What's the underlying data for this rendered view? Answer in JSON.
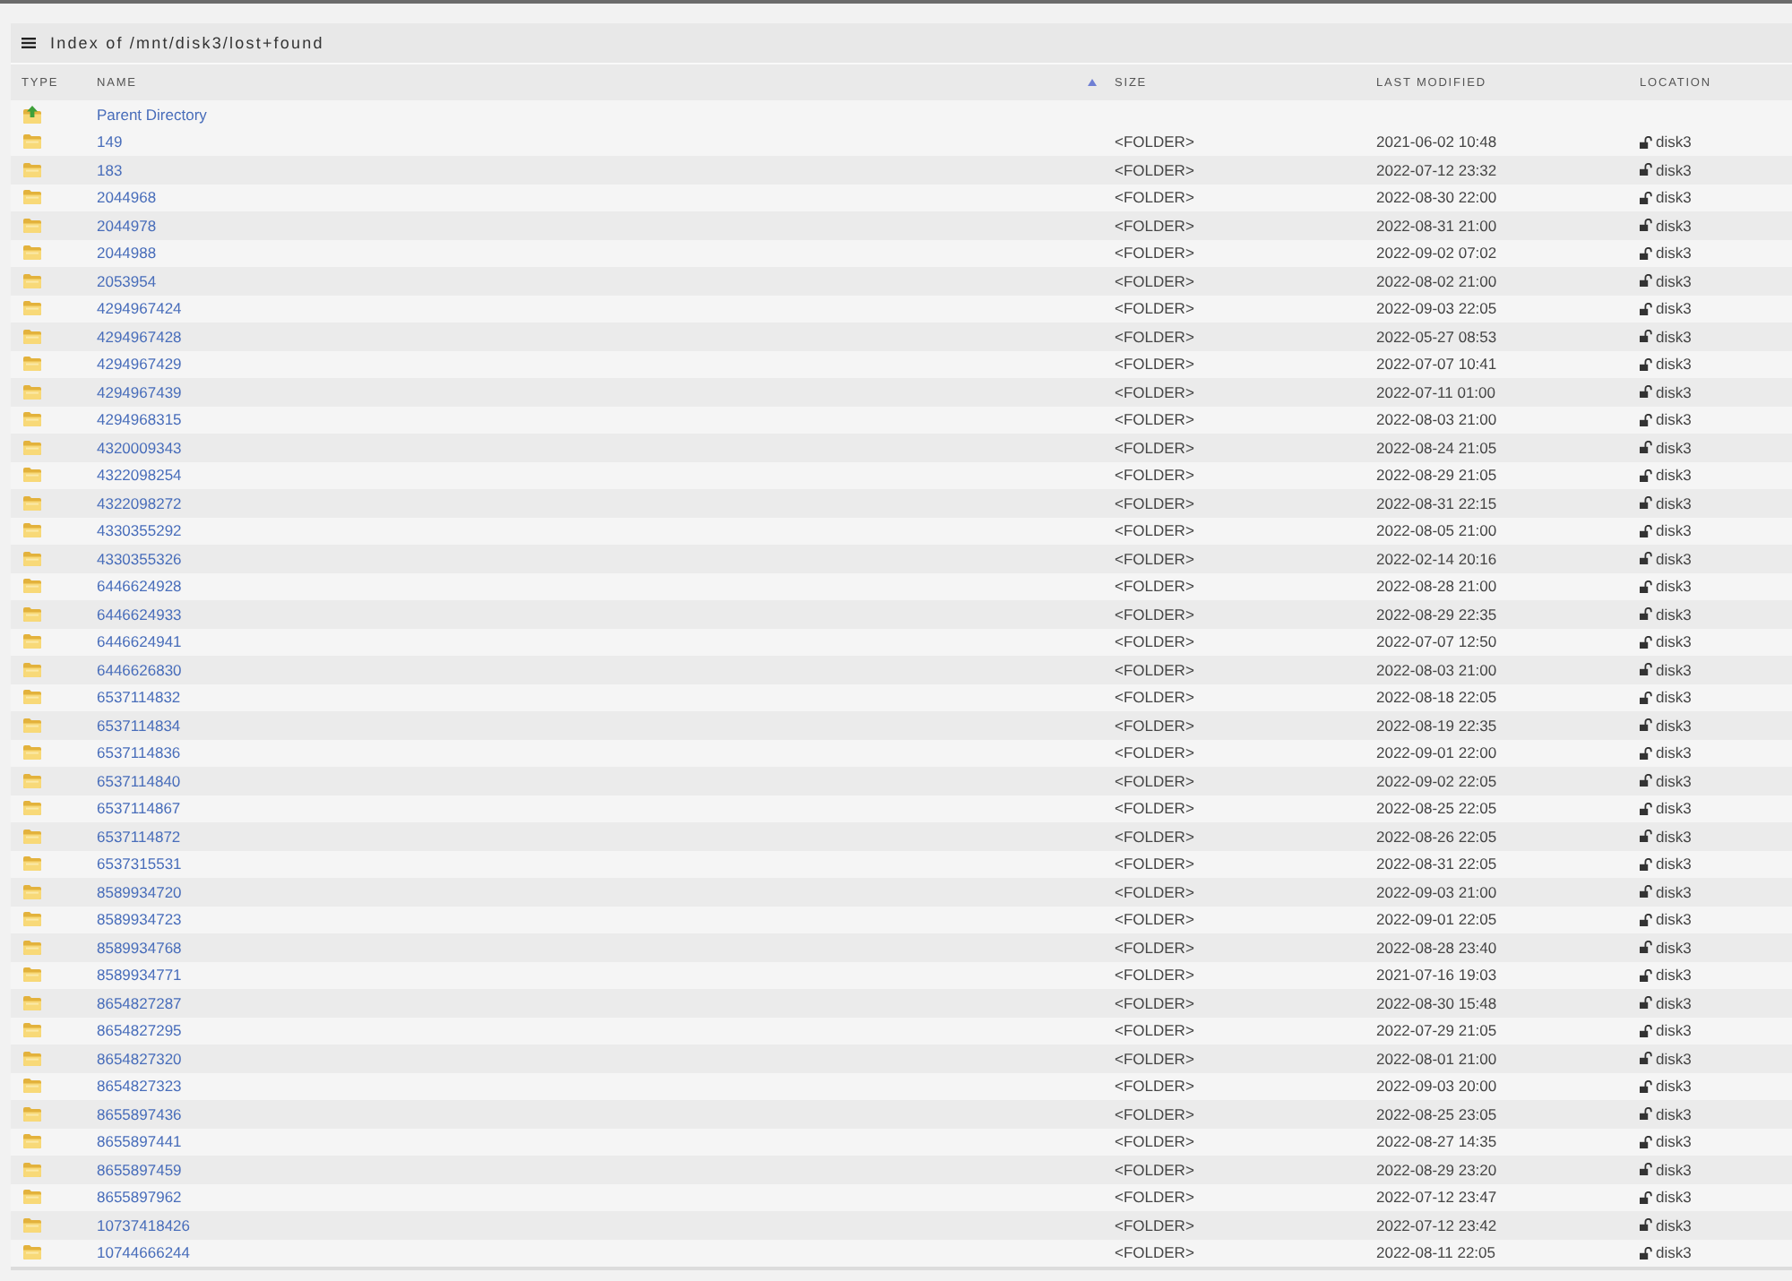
{
  "window": {
    "title": "Index of /mnt/disk3/lost+found"
  },
  "table": {
    "columns": [
      {
        "label": "TYPE",
        "sorted": false
      },
      {
        "label": "NAME",
        "sorted": true
      },
      {
        "label": "SIZE",
        "sorted": false
      },
      {
        "label": "LAST MODIFIED",
        "sorted": false
      },
      {
        "label": "LOCATION",
        "sorted": false
      }
    ],
    "rows": [
      {
        "kind": "parent",
        "name": "Parent Directory"
      },
      {
        "kind": "folder",
        "name": "149",
        "size": "<FOLDER>",
        "modified": "2021-06-02 10:48",
        "location": "disk3",
        "locked": false
      },
      {
        "kind": "folder",
        "name": "183",
        "size": "<FOLDER>",
        "modified": "2022-07-12 23:32",
        "location": "disk3",
        "locked": false
      },
      {
        "kind": "folder",
        "name": "2044968",
        "size": "<FOLDER>",
        "modified": "2022-08-30 22:00",
        "location": "disk3",
        "locked": false
      },
      {
        "kind": "folder",
        "name": "2044978",
        "size": "<FOLDER>",
        "modified": "2022-08-31 21:00",
        "location": "disk3",
        "locked": false
      },
      {
        "kind": "folder",
        "name": "2044988",
        "size": "<FOLDER>",
        "modified": "2022-09-02 07:02",
        "location": "disk3",
        "locked": false
      },
      {
        "kind": "folder",
        "name": "2053954",
        "size": "<FOLDER>",
        "modified": "2022-08-02 21:00",
        "location": "disk3",
        "locked": false
      },
      {
        "kind": "folder",
        "name": "4294967424",
        "size": "<FOLDER>",
        "modified": "2022-09-03 22:05",
        "location": "disk3",
        "locked": false
      },
      {
        "kind": "folder",
        "name": "4294967428",
        "size": "<FOLDER>",
        "modified": "2022-05-27 08:53",
        "location": "disk3",
        "locked": false
      },
      {
        "kind": "folder",
        "name": "4294967429",
        "size": "<FOLDER>",
        "modified": "2022-07-07 10:41",
        "location": "disk3",
        "locked": false
      },
      {
        "kind": "folder",
        "name": "4294967439",
        "size": "<FOLDER>",
        "modified": "2022-07-11 01:00",
        "location": "disk3",
        "locked": false
      },
      {
        "kind": "folder",
        "name": "4294968315",
        "size": "<FOLDER>",
        "modified": "2022-08-03 21:00",
        "location": "disk3",
        "locked": false
      },
      {
        "kind": "folder",
        "name": "4320009343",
        "size": "<FOLDER>",
        "modified": "2022-08-24 21:05",
        "location": "disk3",
        "locked": false
      },
      {
        "kind": "folder",
        "name": "4322098254",
        "size": "<FOLDER>",
        "modified": "2022-08-29 21:05",
        "location": "disk3",
        "locked": false
      },
      {
        "kind": "folder",
        "name": "4322098272",
        "size": "<FOLDER>",
        "modified": "2022-08-31 22:15",
        "location": "disk3",
        "locked": false
      },
      {
        "kind": "folder",
        "name": "4330355292",
        "size": "<FOLDER>",
        "modified": "2022-08-05 21:00",
        "location": "disk3",
        "locked": false
      },
      {
        "kind": "folder",
        "name": "4330355326",
        "size": "<FOLDER>",
        "modified": "2022-02-14 20:16",
        "location": "disk3",
        "locked": false
      },
      {
        "kind": "folder",
        "name": "6446624928",
        "size": "<FOLDER>",
        "modified": "2022-08-28 21:00",
        "location": "disk3",
        "locked": false
      },
      {
        "kind": "folder",
        "name": "6446624933",
        "size": "<FOLDER>",
        "modified": "2022-08-29 22:35",
        "location": "disk3",
        "locked": false
      },
      {
        "kind": "folder",
        "name": "6446624941",
        "size": "<FOLDER>",
        "modified": "2022-07-07 12:50",
        "location": "disk3",
        "locked": false
      },
      {
        "kind": "folder",
        "name": "6446626830",
        "size": "<FOLDER>",
        "modified": "2022-08-03 21:00",
        "location": "disk3",
        "locked": false
      },
      {
        "kind": "folder",
        "name": "6537114832",
        "size": "<FOLDER>",
        "modified": "2022-08-18 22:05",
        "location": "disk3",
        "locked": false
      },
      {
        "kind": "folder",
        "name": "6537114834",
        "size": "<FOLDER>",
        "modified": "2022-08-19 22:35",
        "location": "disk3",
        "locked": false
      },
      {
        "kind": "folder",
        "name": "6537114836",
        "size": "<FOLDER>",
        "modified": "2022-09-01 22:00",
        "location": "disk3",
        "locked": false
      },
      {
        "kind": "folder",
        "name": "6537114840",
        "size": "<FOLDER>",
        "modified": "2022-09-02 22:05",
        "location": "disk3",
        "locked": false
      },
      {
        "kind": "folder",
        "name": "6537114867",
        "size": "<FOLDER>",
        "modified": "2022-08-25 22:05",
        "location": "disk3",
        "locked": false
      },
      {
        "kind": "folder",
        "name": "6537114872",
        "size": "<FOLDER>",
        "modified": "2022-08-26 22:05",
        "location": "disk3",
        "locked": false
      },
      {
        "kind": "folder",
        "name": "6537315531",
        "size": "<FOLDER>",
        "modified": "2022-08-31 22:05",
        "location": "disk3",
        "locked": false
      },
      {
        "kind": "folder",
        "name": "8589934720",
        "size": "<FOLDER>",
        "modified": "2022-09-03 21:00",
        "location": "disk3",
        "locked": false
      },
      {
        "kind": "folder",
        "name": "8589934723",
        "size": "<FOLDER>",
        "modified": "2022-09-01 22:05",
        "location": "disk3",
        "locked": false
      },
      {
        "kind": "folder",
        "name": "8589934768",
        "size": "<FOLDER>",
        "modified": "2022-08-28 23:40",
        "location": "disk3",
        "locked": false
      },
      {
        "kind": "folder",
        "name": "8589934771",
        "size": "<FOLDER>",
        "modified": "2021-07-16 19:03",
        "location": "disk3",
        "locked": false
      },
      {
        "kind": "folder",
        "name": "8654827287",
        "size": "<FOLDER>",
        "modified": "2022-08-30 15:48",
        "location": "disk3",
        "locked": false
      },
      {
        "kind": "folder",
        "name": "8654827295",
        "size": "<FOLDER>",
        "modified": "2022-07-29 21:05",
        "location": "disk3",
        "locked": false
      },
      {
        "kind": "folder",
        "name": "8654827320",
        "size": "<FOLDER>",
        "modified": "2022-08-01 21:00",
        "location": "disk3",
        "locked": false
      },
      {
        "kind": "folder",
        "name": "8654827323",
        "size": "<FOLDER>",
        "modified": "2022-09-03 20:00",
        "location": "disk3",
        "locked": false
      },
      {
        "kind": "folder",
        "name": "8655897436",
        "size": "<FOLDER>",
        "modified": "2022-08-25 23:05",
        "location": "disk3",
        "locked": false
      },
      {
        "kind": "folder",
        "name": "8655897441",
        "size": "<FOLDER>",
        "modified": "2022-08-27 14:35",
        "location": "disk3",
        "locked": false
      },
      {
        "kind": "folder",
        "name": "8655897459",
        "size": "<FOLDER>",
        "modified": "2022-08-29 23:20",
        "location": "disk3",
        "locked": false
      },
      {
        "kind": "folder",
        "name": "8655897962",
        "size": "<FOLDER>",
        "modified": "2022-07-12 23:47",
        "location": "disk3",
        "locked": false
      },
      {
        "kind": "folder",
        "name": "10737418426",
        "size": "<FOLDER>",
        "modified": "2022-07-12 23:42",
        "location": "disk3",
        "locked": false
      },
      {
        "kind": "folder",
        "name": "10744666244",
        "size": "<FOLDER>",
        "modified": "2022-08-11 22:05",
        "location": "disk3",
        "locked": false
      }
    ]
  }
}
